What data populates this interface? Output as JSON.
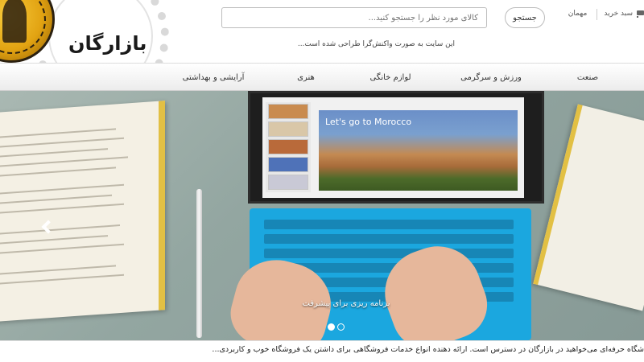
{
  "header": {
    "logo_text": "بازارگان",
    "search_placeholder": "کالای مورد نظر را جستجو کنید...",
    "search_button": "جستجو",
    "tagline": "این سایت به صورت واکنش‌گرا طراحی شده است...",
    "guest_label": "مهمان",
    "cart_label": "سبد خرید"
  },
  "nav": {
    "items": [
      {
        "label": "صنعت"
      },
      {
        "label": "ورزش و سرگرمی"
      },
      {
        "label": "لوازم خانگی"
      },
      {
        "label": "هنری"
      },
      {
        "label": "آرایشی و بهداشتی"
      }
    ]
  },
  "hero": {
    "slide_title": "Let's go to Morocco",
    "caption": "برنامه ریزی برای پیشرفت",
    "slides": 2,
    "active_slide": 1
  },
  "marquee": {
    "text": "شگاه حرفه‌ای می‌خواهید در بازارگان در دسترس است. ارائه دهنده انواع خدمات فروشگاهی برای داشتن یک فروشگاه خوب و کاربردی..."
  },
  "colors": {
    "accent_keyboard": "#1ba7df",
    "coin_gold": "#e2a312"
  }
}
